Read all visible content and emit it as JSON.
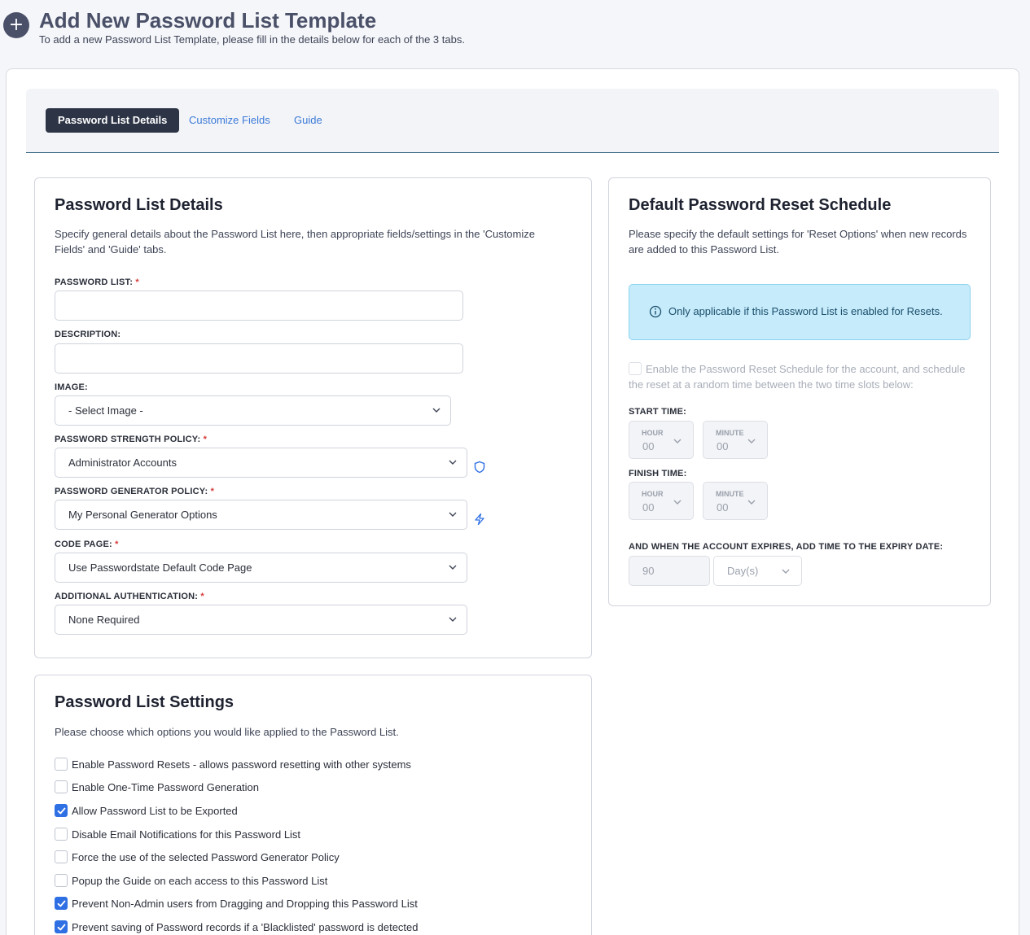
{
  "header": {
    "title": "Add New Password List Template",
    "subtitle": "To add a new Password List Template, please fill in the details below for each of the 3 tabs.",
    "plus_glyph": "+"
  },
  "tabs": [
    {
      "label": "Password List Details",
      "active": true
    },
    {
      "label": "Customize Fields",
      "active": false
    },
    {
      "label": "Guide",
      "active": false
    }
  ],
  "details": {
    "title": "Password List Details",
    "description": "Specify general details about the Password List here, then appropriate fields/settings in the 'Customize Fields' and 'Guide' tabs.",
    "password_list_label": "PASSWORD LIST:",
    "password_list_value": "",
    "description_label": "DESCRIPTION:",
    "description_value": "",
    "image_label": "IMAGE:",
    "image_value": "- Select Image -",
    "strength_label": "PASSWORD STRENGTH POLICY:",
    "strength_value": "Administrator Accounts",
    "generator_label": "PASSWORD GENERATOR POLICY:",
    "generator_value": "My Personal Generator Options",
    "codepage_label": "CODE PAGE:",
    "codepage_value": "Use Passwordstate Default Code Page",
    "auth_label": "ADDITIONAL AUTHENTICATION:",
    "auth_value": "None Required",
    "required_mark": "*"
  },
  "schedule": {
    "title": "Default Password Reset Schedule",
    "description": "Please specify the default settings for 'Reset Options' when new records are added to this Password List.",
    "info": "Only applicable if this Password List is enabled for Resets.",
    "enable_label": "Enable the Password Reset Schedule for the account, and schedule the reset at a random time between the two time slots below:",
    "enable_checked": false,
    "start_label": "START TIME:",
    "finish_label": "FINISH TIME:",
    "hour_caption": "HOUR",
    "minute_caption": "MINUTE",
    "start_hour": "00",
    "start_minute": "00",
    "finish_hour": "00",
    "finish_minute": "00",
    "expiry_label": "AND WHEN THE ACCOUNT EXPIRES, ADD TIME TO THE EXPIRY DATE:",
    "expiry_value": "90",
    "expiry_unit": "Day(s)"
  },
  "settings": {
    "title": "Password List Settings",
    "description": "Please choose which options you would like applied to the Password List.",
    "options": [
      {
        "label": "Enable Password Resets - allows password resetting with other systems",
        "checked": false
      },
      {
        "label": "Enable One-Time Password Generation",
        "checked": false
      },
      {
        "label": "Allow Password List to be Exported",
        "checked": true
      },
      {
        "label": "Disable Email Notifications for this Password List",
        "checked": false
      },
      {
        "label": "Force the use of the selected Password Generator Policy",
        "checked": false
      },
      {
        "label": "Popup the Guide on each access to this Password List",
        "checked": false
      },
      {
        "label": "Prevent Non-Admin users from Dragging and Dropping this Password List",
        "checked": true
      },
      {
        "label": "Prevent saving of Password records if a 'Blacklisted' password is detected",
        "checked": true
      }
    ]
  },
  "colors": {
    "accent": "#2f6fe4",
    "tab_active_bg": "#2d3446",
    "info_bg": "#c6ebfb",
    "required": "#d63a3a"
  },
  "icons": {
    "plus": "plus-icon",
    "chevron": "chevron-down-icon",
    "shield": "shield-icon",
    "bolt": "lightning-icon",
    "info": "info-icon",
    "check": "checkmark-icon"
  }
}
